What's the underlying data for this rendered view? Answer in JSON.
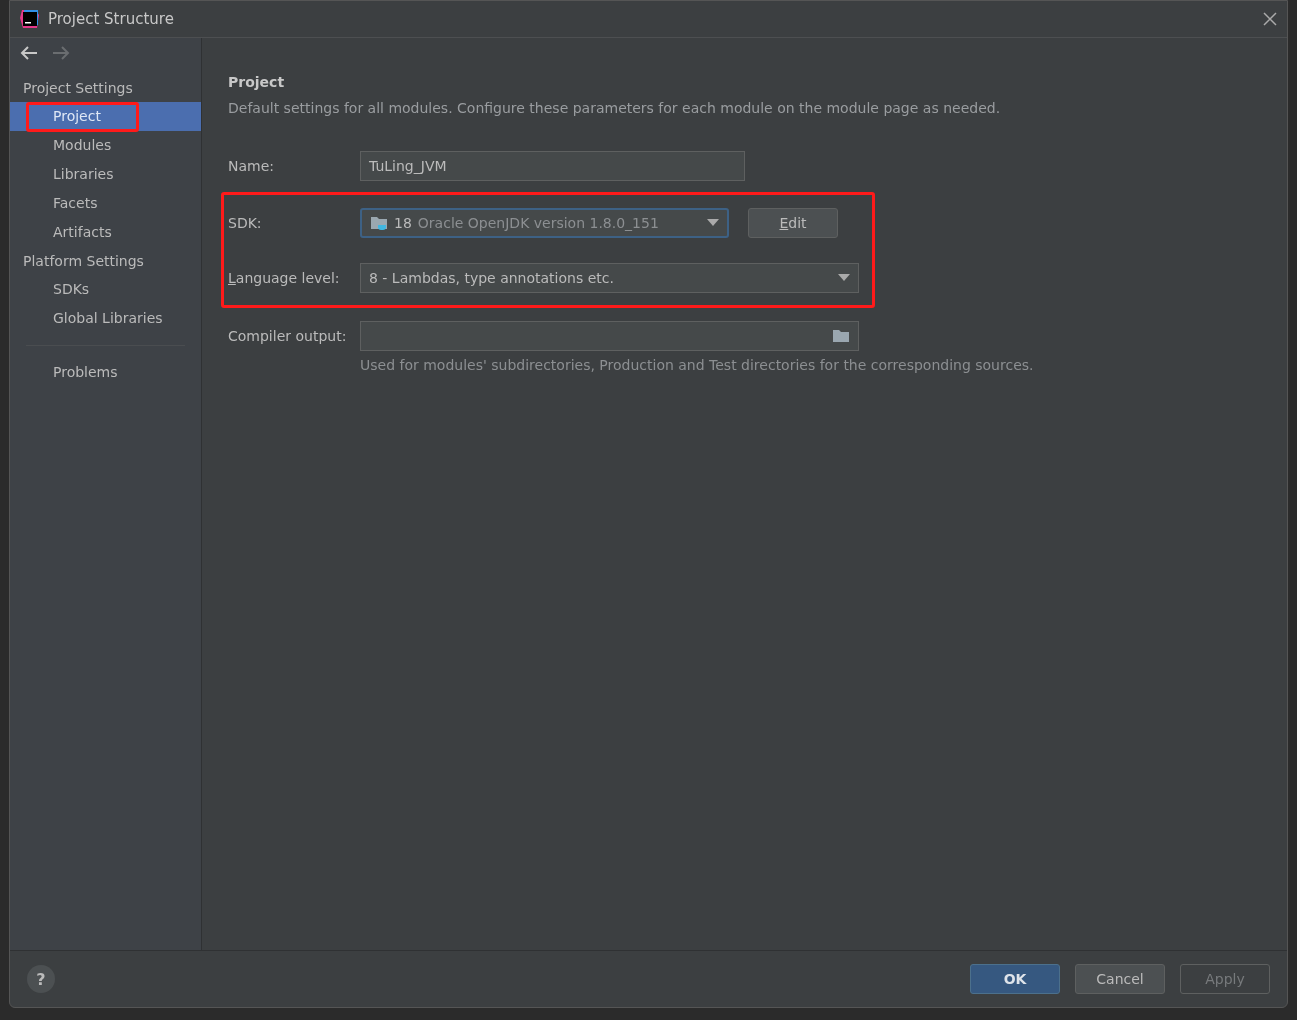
{
  "window": {
    "title": "Project Structure"
  },
  "sidebar": {
    "sections": [
      {
        "heading": "Project Settings",
        "items": [
          {
            "label": "Project",
            "selected": true,
            "highlighted": true
          },
          {
            "label": "Modules",
            "selected": false,
            "highlighted": false
          },
          {
            "label": "Libraries",
            "selected": false,
            "highlighted": false
          },
          {
            "label": "Facets",
            "selected": false,
            "highlighted": false
          },
          {
            "label": "Artifacts",
            "selected": false,
            "highlighted": false
          }
        ]
      },
      {
        "heading": "Platform Settings",
        "items": [
          {
            "label": "SDKs",
            "selected": false,
            "highlighted": false
          },
          {
            "label": "Global Libraries",
            "selected": false,
            "highlighted": false
          }
        ]
      },
      {
        "items": [
          {
            "label": "Problems",
            "selected": false,
            "highlighted": false
          }
        ]
      }
    ]
  },
  "content": {
    "title": "Project",
    "description": "Default settings for all modules. Configure these parameters for each module on the module page as needed.",
    "fields": [
      {
        "kind": "text",
        "label": "Name:",
        "value": "TuLing_JVM",
        "highlighted": false,
        "mnemonic": false
      },
      {
        "kind": "sdk",
        "label": "SDK:",
        "number": "18",
        "value": "Oracle OpenJDK version 1.8.0_151",
        "button": "Edit",
        "focused": true,
        "highlighted": true,
        "mnemonic": false
      },
      {
        "kind": "combo",
        "label": "Language level:",
        "value": "8 - Lambdas, type annotations etc.",
        "highlighted": true,
        "mnemonic": true
      },
      {
        "kind": "path",
        "label": "Compiler output:",
        "hint": "Used for modules' subdirectories, Production and Test directories for the corresponding sources.",
        "highlighted": false,
        "mnemonic": false
      }
    ]
  },
  "footer": {
    "help": "?",
    "buttons": [
      {
        "label": "OK",
        "kind": "default",
        "disabled": false
      },
      {
        "label": "Cancel",
        "kind": "normal",
        "disabled": false
      },
      {
        "label": "Apply",
        "kind": "normal",
        "disabled": true
      }
    ]
  }
}
